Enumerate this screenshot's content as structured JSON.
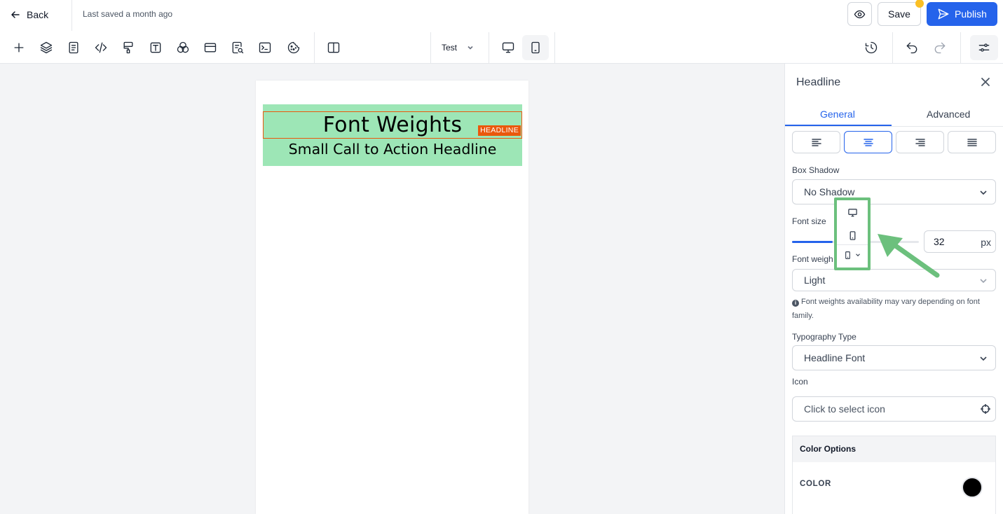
{
  "header": {
    "back_label": "Back",
    "last_saved": "Last saved a month ago",
    "save_label": "Save",
    "publish_label": "Publish"
  },
  "toolbar": {
    "tools": [
      "add-icon",
      "layers-icon",
      "page-icon",
      "code-icon",
      "paint-roller-icon",
      "text-icon",
      "color-circles-icon",
      "section-icon",
      "page-search-icon",
      "terminal-icon",
      "cookie-icon",
      "split-view-icon"
    ],
    "variant_label": "Test",
    "device_desktop": "monitor-icon",
    "device_mobile": "mobile-icon",
    "active_device": "mobile"
  },
  "canvas": {
    "headline": "Font Weights",
    "badge": "HEADLINE",
    "subheadline": "Small Call to Action Headline",
    "hero_bg": "#9de6b6",
    "selection_color": "#ea580c"
  },
  "panel": {
    "title": "Headline",
    "tabs": [
      {
        "label": "General",
        "active": true
      },
      {
        "label": "Advanced",
        "active": false
      }
    ],
    "alignment_active": "center",
    "box_shadow_label": "Box Shadow",
    "box_shadow_value": "No Shadow",
    "font_size_label": "Font size",
    "font_size_value": "32",
    "font_size_unit": "px",
    "font_size_slider_fraction": 0.32,
    "font_weight_label": "Font weigh",
    "font_weight_value": "Light",
    "font_weight_hint": "Font weights availability may vary depending on font family.",
    "typography_label": "Typography Type",
    "typography_value": "Headline Font",
    "icon_label": "Icon",
    "icon_placeholder": "Click to select icon",
    "color_options_label": "Color Options",
    "color_label": "COLOR",
    "color_value": "#000000"
  },
  "colors": {
    "accent": "#2563eb",
    "highlight_green": "#6cc07d",
    "notification": "#fbbf24"
  }
}
